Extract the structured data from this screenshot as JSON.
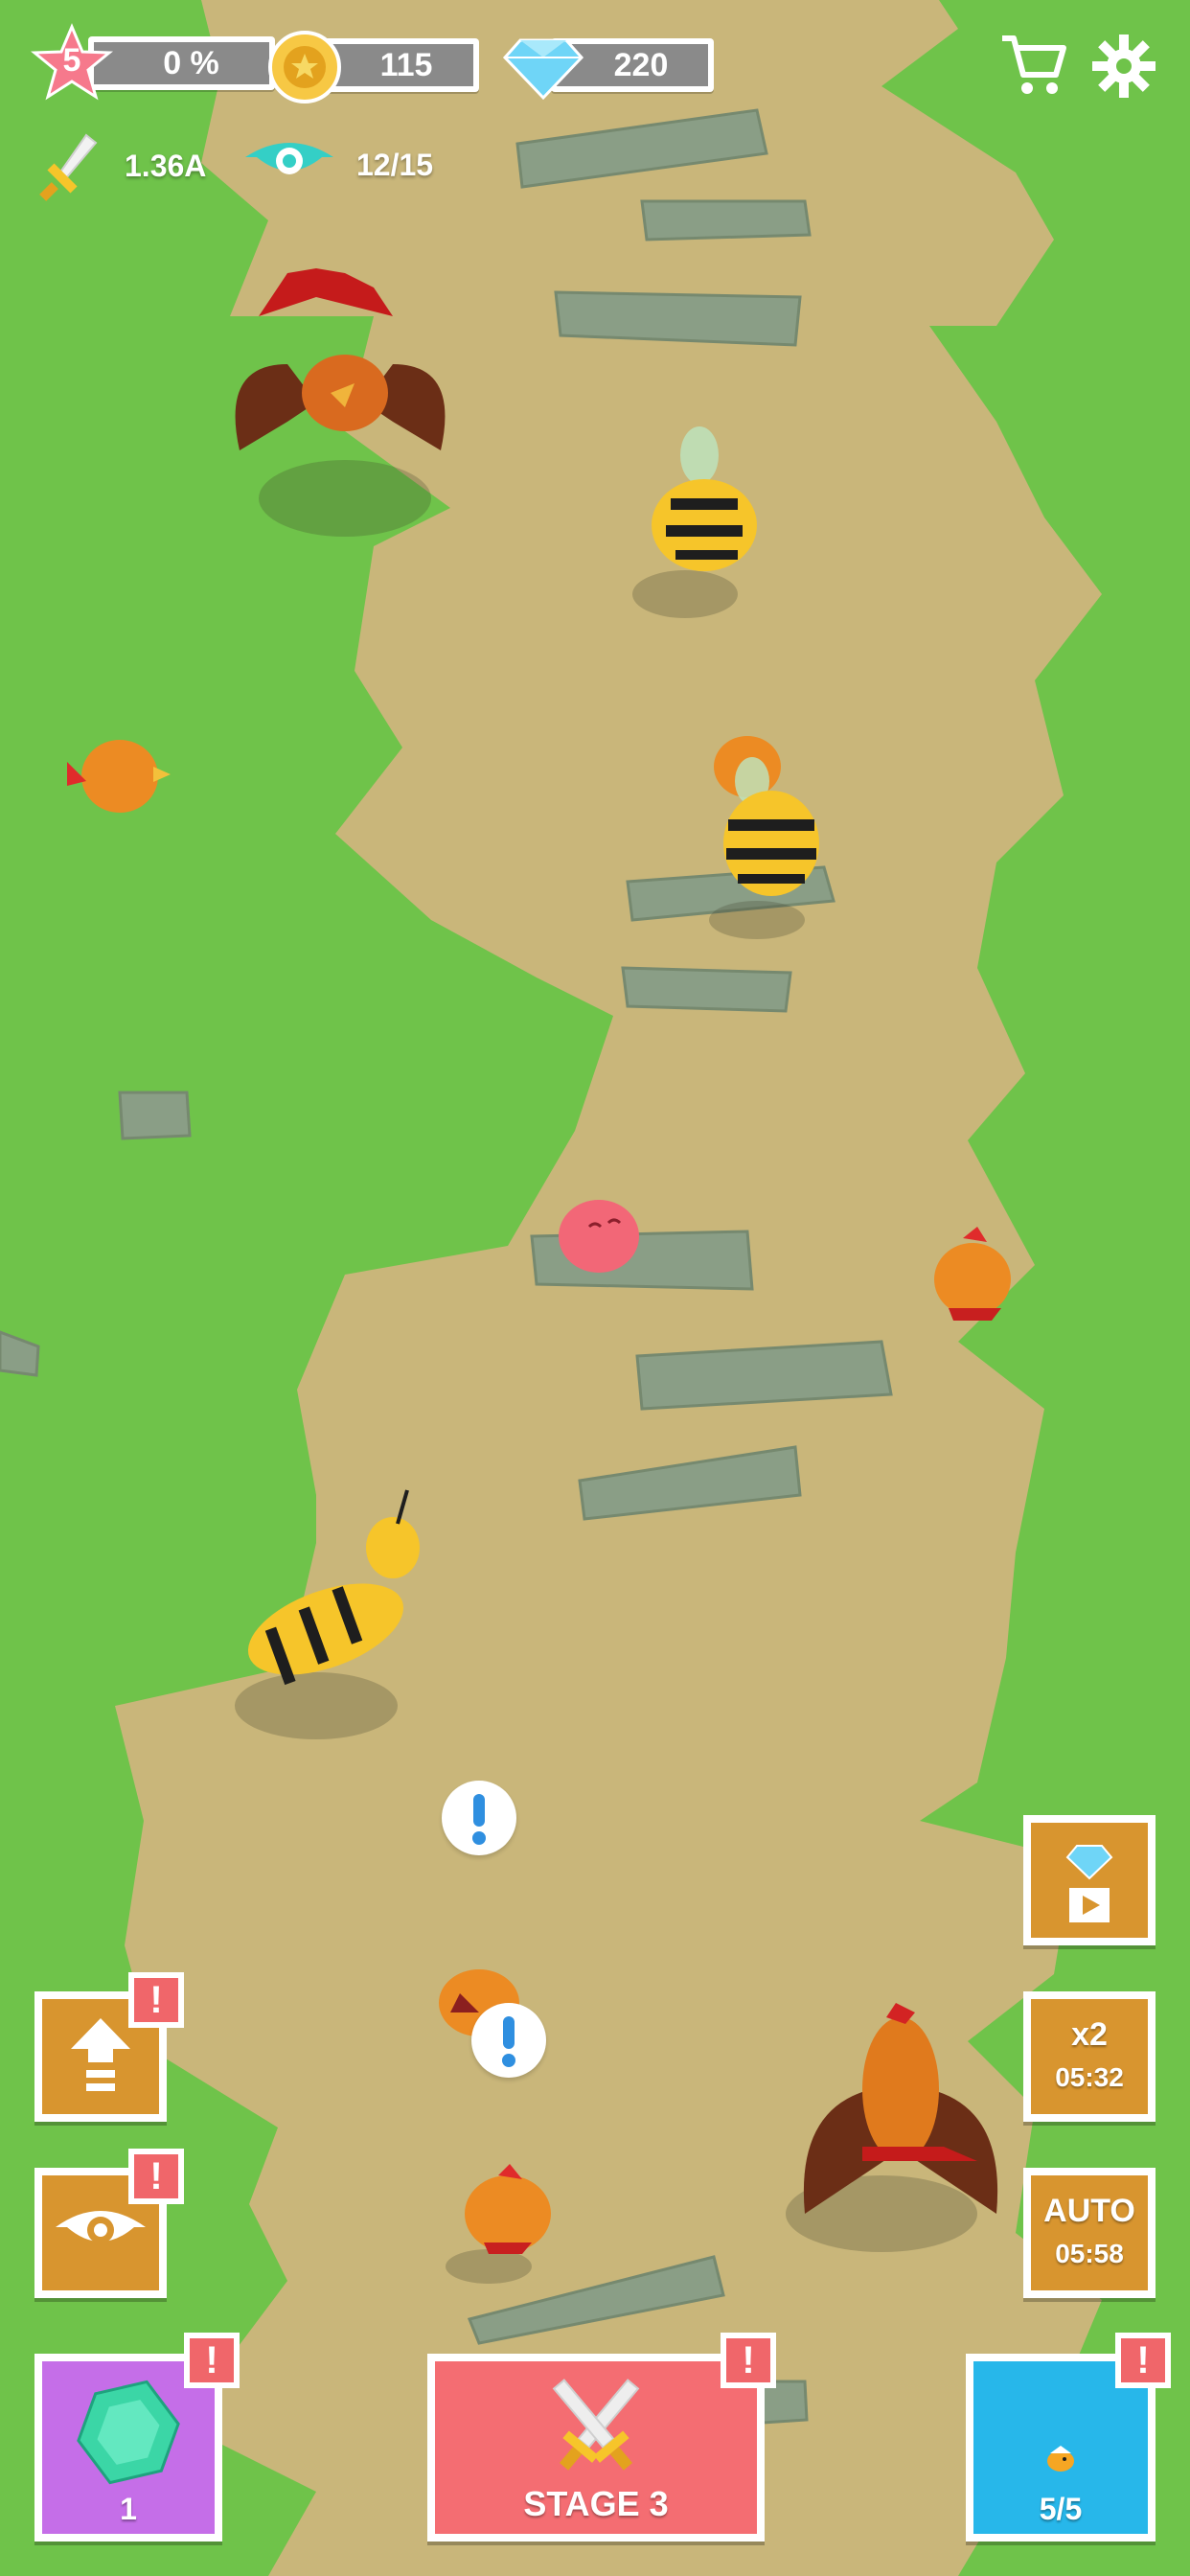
{
  "top_bar": {
    "level": "5",
    "progress": "0 %",
    "coins": "115",
    "gems": "220"
  },
  "stats": {
    "attack": "1.36A",
    "capacity": "12/15"
  },
  "side_buttons": {
    "speed_label": "x2",
    "speed_timer": "05:32",
    "auto_label": "AUTO",
    "auto_timer": "05:58"
  },
  "bottom": {
    "gem_count": "1",
    "stage_label": "STAGE 3",
    "team_count": "5/5"
  },
  "alert_mark": "!",
  "colors": {
    "grass": "#6fc34a",
    "path": "#c9b67a",
    "stone": "#8a9e86",
    "orange_button": "#d8952f",
    "alert_red": "#f0666a",
    "purple_button": "#c56ee8",
    "stage_button": "#f46d72",
    "blue_button": "#27b7ea",
    "speech_exclamation": "#2f8fe0"
  }
}
